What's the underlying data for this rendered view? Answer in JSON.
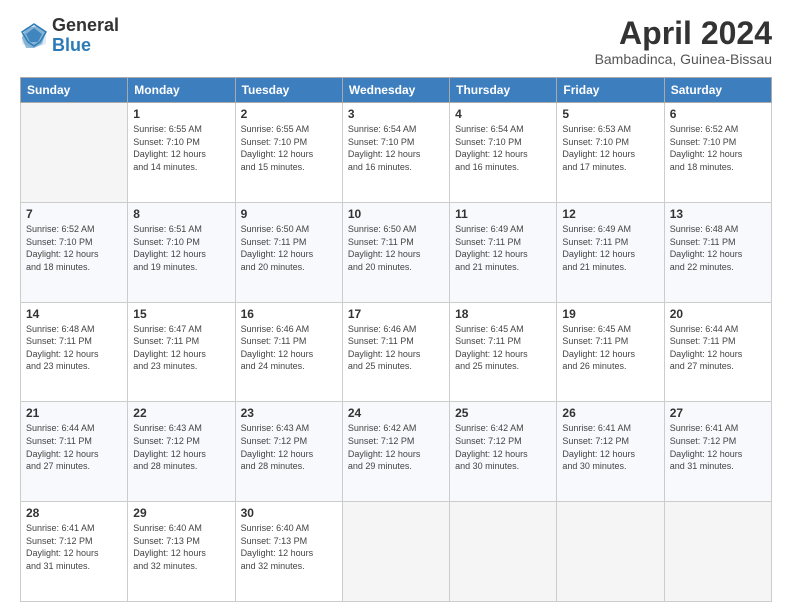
{
  "header": {
    "logo_general": "General",
    "logo_blue": "Blue",
    "title": "April 2024",
    "subtitle": "Bambadinca, Guinea-Bissau"
  },
  "calendar": {
    "days_of_week": [
      "Sunday",
      "Monday",
      "Tuesday",
      "Wednesday",
      "Thursday",
      "Friday",
      "Saturday"
    ],
    "weeks": [
      [
        {
          "day": null,
          "info": null
        },
        {
          "day": "1",
          "info": "Sunrise: 6:55 AM\nSunset: 7:10 PM\nDaylight: 12 hours\nand 14 minutes."
        },
        {
          "day": "2",
          "info": "Sunrise: 6:55 AM\nSunset: 7:10 PM\nDaylight: 12 hours\nand 15 minutes."
        },
        {
          "day": "3",
          "info": "Sunrise: 6:54 AM\nSunset: 7:10 PM\nDaylight: 12 hours\nand 16 minutes."
        },
        {
          "day": "4",
          "info": "Sunrise: 6:54 AM\nSunset: 7:10 PM\nDaylight: 12 hours\nand 16 minutes."
        },
        {
          "day": "5",
          "info": "Sunrise: 6:53 AM\nSunset: 7:10 PM\nDaylight: 12 hours\nand 17 minutes."
        },
        {
          "day": "6",
          "info": "Sunrise: 6:52 AM\nSunset: 7:10 PM\nDaylight: 12 hours\nand 18 minutes."
        }
      ],
      [
        {
          "day": "7",
          "info": "Sunrise: 6:52 AM\nSunset: 7:10 PM\nDaylight: 12 hours\nand 18 minutes."
        },
        {
          "day": "8",
          "info": "Sunrise: 6:51 AM\nSunset: 7:10 PM\nDaylight: 12 hours\nand 19 minutes."
        },
        {
          "day": "9",
          "info": "Sunrise: 6:50 AM\nSunset: 7:11 PM\nDaylight: 12 hours\nand 20 minutes."
        },
        {
          "day": "10",
          "info": "Sunrise: 6:50 AM\nSunset: 7:11 PM\nDaylight: 12 hours\nand 20 minutes."
        },
        {
          "day": "11",
          "info": "Sunrise: 6:49 AM\nSunset: 7:11 PM\nDaylight: 12 hours\nand 21 minutes."
        },
        {
          "day": "12",
          "info": "Sunrise: 6:49 AM\nSunset: 7:11 PM\nDaylight: 12 hours\nand 21 minutes."
        },
        {
          "day": "13",
          "info": "Sunrise: 6:48 AM\nSunset: 7:11 PM\nDaylight: 12 hours\nand 22 minutes."
        }
      ],
      [
        {
          "day": "14",
          "info": "Sunrise: 6:48 AM\nSunset: 7:11 PM\nDaylight: 12 hours\nand 23 minutes."
        },
        {
          "day": "15",
          "info": "Sunrise: 6:47 AM\nSunset: 7:11 PM\nDaylight: 12 hours\nand 23 minutes."
        },
        {
          "day": "16",
          "info": "Sunrise: 6:46 AM\nSunset: 7:11 PM\nDaylight: 12 hours\nand 24 minutes."
        },
        {
          "day": "17",
          "info": "Sunrise: 6:46 AM\nSunset: 7:11 PM\nDaylight: 12 hours\nand 25 minutes."
        },
        {
          "day": "18",
          "info": "Sunrise: 6:45 AM\nSunset: 7:11 PM\nDaylight: 12 hours\nand 25 minutes."
        },
        {
          "day": "19",
          "info": "Sunrise: 6:45 AM\nSunset: 7:11 PM\nDaylight: 12 hours\nand 26 minutes."
        },
        {
          "day": "20",
          "info": "Sunrise: 6:44 AM\nSunset: 7:11 PM\nDaylight: 12 hours\nand 27 minutes."
        }
      ],
      [
        {
          "day": "21",
          "info": "Sunrise: 6:44 AM\nSunset: 7:11 PM\nDaylight: 12 hours\nand 27 minutes."
        },
        {
          "day": "22",
          "info": "Sunrise: 6:43 AM\nSunset: 7:12 PM\nDaylight: 12 hours\nand 28 minutes."
        },
        {
          "day": "23",
          "info": "Sunrise: 6:43 AM\nSunset: 7:12 PM\nDaylight: 12 hours\nand 28 minutes."
        },
        {
          "day": "24",
          "info": "Sunrise: 6:42 AM\nSunset: 7:12 PM\nDaylight: 12 hours\nand 29 minutes."
        },
        {
          "day": "25",
          "info": "Sunrise: 6:42 AM\nSunset: 7:12 PM\nDaylight: 12 hours\nand 30 minutes."
        },
        {
          "day": "26",
          "info": "Sunrise: 6:41 AM\nSunset: 7:12 PM\nDaylight: 12 hours\nand 30 minutes."
        },
        {
          "day": "27",
          "info": "Sunrise: 6:41 AM\nSunset: 7:12 PM\nDaylight: 12 hours\nand 31 minutes."
        }
      ],
      [
        {
          "day": "28",
          "info": "Sunrise: 6:41 AM\nSunset: 7:12 PM\nDaylight: 12 hours\nand 31 minutes."
        },
        {
          "day": "29",
          "info": "Sunrise: 6:40 AM\nSunset: 7:13 PM\nDaylight: 12 hours\nand 32 minutes."
        },
        {
          "day": "30",
          "info": "Sunrise: 6:40 AM\nSunset: 7:13 PM\nDaylight: 12 hours\nand 32 minutes."
        },
        {
          "day": null,
          "info": null
        },
        {
          "day": null,
          "info": null
        },
        {
          "day": null,
          "info": null
        },
        {
          "day": null,
          "info": null
        }
      ]
    ]
  }
}
